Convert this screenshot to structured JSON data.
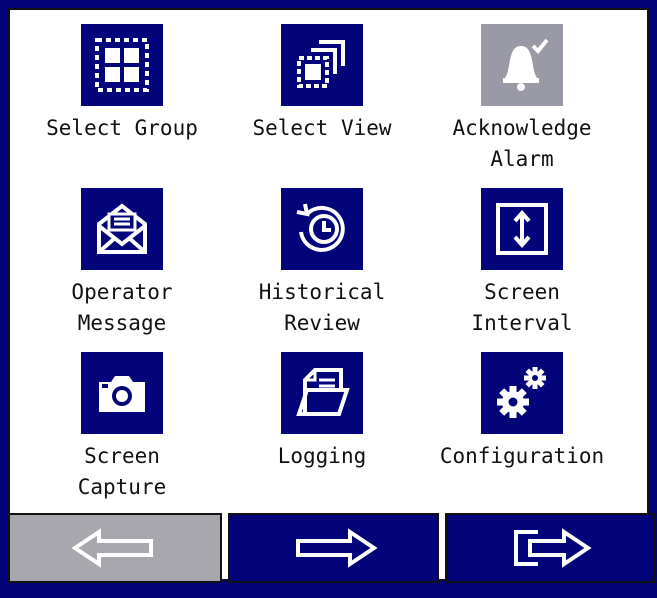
{
  "menu": {
    "items": [
      {
        "label": "Select Group",
        "icon": "select-group-icon"
      },
      {
        "label": "Select View",
        "icon": "select-view-icon"
      },
      {
        "label": "Acknowledge\nAlarm",
        "icon": "acknowledge-alarm-icon",
        "disabled": true
      },
      {
        "label": "Operator\nMessage",
        "icon": "operator-message-icon"
      },
      {
        "label": "Historical\nReview",
        "icon": "historical-review-icon"
      },
      {
        "label": "Screen\nInterval",
        "icon": "screen-interval-icon"
      },
      {
        "label": "Screen\nCapture",
        "icon": "screen-capture-icon"
      },
      {
        "label": "Logging",
        "icon": "logging-icon"
      },
      {
        "label": "Configuration",
        "icon": "configuration-icon"
      }
    ]
  },
  "nav": {
    "back_icon": "arrow-left-icon",
    "forward_icon": "arrow-right-icon",
    "exit_icon": "exit-arrow-icon"
  },
  "colors": {
    "accent": "#04047a",
    "disabled": "#9a9aa6",
    "back_button": "#a7a7ad"
  }
}
